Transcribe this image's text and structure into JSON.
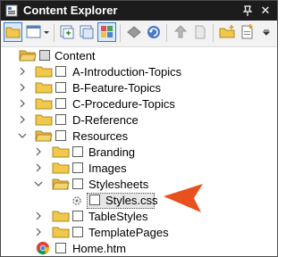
{
  "window": {
    "title": "Content Explorer",
    "pin_glyph": "📌",
    "close_glyph": "✕"
  },
  "toolbar": {
    "tools": [
      {
        "name": "open-folder-tool-icon"
      },
      {
        "name": "view-mode-tool-icon"
      },
      {
        "name": "dropdown-arrow-icon"
      },
      {
        "name": "new-window-tool-icon"
      },
      {
        "name": "duplicate-window-tool-icon"
      },
      {
        "name": "show-files-grid-icon"
      },
      {
        "name": "bind-tool-icon"
      },
      {
        "name": "refresh-tool-icon"
      },
      {
        "name": "up-tool-icon"
      },
      {
        "name": "blank-page-tool-icon"
      },
      {
        "name": "new-folder-tool-icon"
      },
      {
        "name": "add-topic-tool-icon"
      }
    ]
  },
  "tree": {
    "root": {
      "label": "Content"
    },
    "items": [
      {
        "label": "A-Introduction-Topics",
        "expanded": false
      },
      {
        "label": "B-Feature-Topics",
        "expanded": false
      },
      {
        "label": "C-Procedure-Topics",
        "expanded": false
      },
      {
        "label": "D-Reference",
        "expanded": false
      },
      {
        "label": "Resources",
        "expanded": true
      },
      {
        "label": "Branding",
        "expanded": false
      },
      {
        "label": "Images",
        "expanded": false
      },
      {
        "label": "Stylesheets",
        "expanded": true
      },
      {
        "label": "Styles.css",
        "selected": true
      },
      {
        "label": "TableStyles",
        "expanded": false
      },
      {
        "label": "TemplatePages",
        "expanded": false
      },
      {
        "label": "Home.htm"
      }
    ]
  },
  "colors": {
    "title_bg": "#1c1c1c",
    "folder_yellow": "#f0c84c",
    "arrow_orange": "#e8501e",
    "selection_border": "#3c78c8"
  }
}
